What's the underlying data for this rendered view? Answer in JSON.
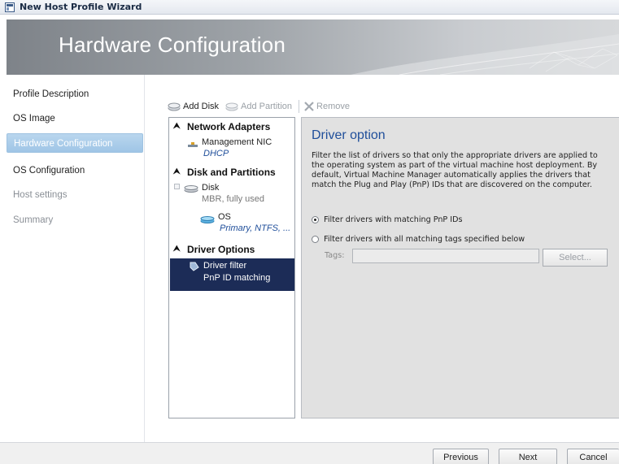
{
  "window": {
    "title": "New Host Profile Wizard",
    "icon": "wizard-window-icon"
  },
  "banner": {
    "heading": "Hardware Configuration"
  },
  "nav": {
    "items": [
      {
        "label": "Profile Description",
        "state": "done"
      },
      {
        "label": "OS Image",
        "state": "done"
      },
      {
        "label": "Hardware Configuration",
        "state": "active"
      },
      {
        "label": "OS Configuration",
        "state": "done"
      },
      {
        "label": "Host settings",
        "state": "future"
      },
      {
        "label": "Summary",
        "state": "future"
      }
    ]
  },
  "toolbar": {
    "add_disk": "Add Disk",
    "add_partition": "Add Partition",
    "remove": "Remove"
  },
  "tree": {
    "groups": {
      "network": "Network Adapters",
      "disks": "Disk and Partitions",
      "drivers": "Driver Options"
    },
    "items": {
      "nic_name": "Management NIC",
      "nic_sub": "DHCP",
      "disk_name": "Disk",
      "disk_sub": "MBR, fully used",
      "partition_name": "OS",
      "partition_sub": "Primary, NTFS, ...",
      "driver_name": "Driver filter",
      "driver_sub": "PnP ID matching"
    }
  },
  "panel": {
    "title": "Driver option",
    "description": "Filter the list of drivers so that only the appropriate drivers are applied to the operating system as part of the virtual machine host deployment. By default, Virtual Machine Manager automatically applies the drivers that match the Plug and Play (PnP) IDs that are discovered on the computer.",
    "option_pnp": "Filter drivers with matching PnP IDs",
    "option_tags": "Filter drivers with all matching tags specified below",
    "tags_label": "Tags:",
    "tags_value": "",
    "select_label": "Select..."
  },
  "footer": {
    "previous": "Previous",
    "next": "Next",
    "cancel": "Cancel"
  },
  "colors": {
    "selection": "#1c2c57",
    "nav_active": "#a9cbe8",
    "title_blue": "#1f4e9a",
    "panel_bg": "#e1e1e1"
  }
}
